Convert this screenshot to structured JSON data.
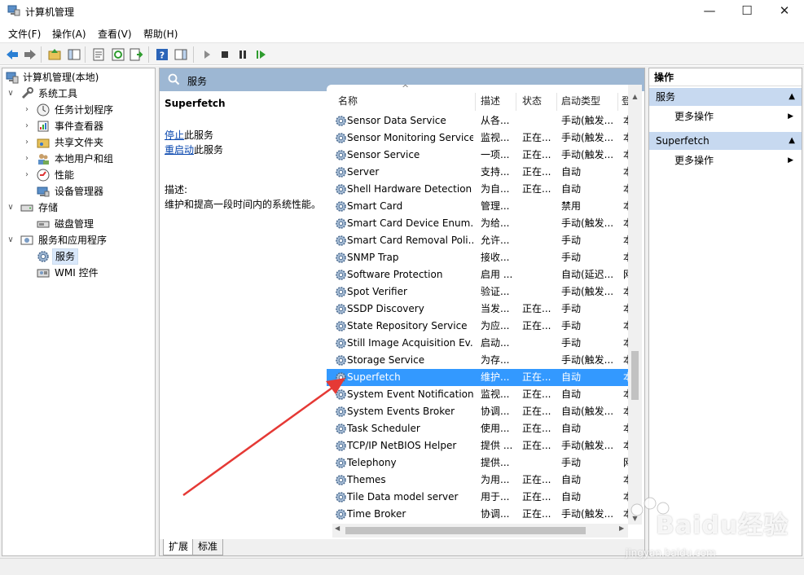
{
  "window": {
    "title": "计算机管理"
  },
  "menubar": [
    "文件(F)",
    "操作(A)",
    "查看(V)",
    "帮助(H)"
  ],
  "tree": {
    "root": "计算机管理(本地)",
    "system_tools": "系统工具",
    "task_scheduler": "任务计划程序",
    "event_viewer": "事件查看器",
    "shared_folders": "共享文件夹",
    "local_users": "本地用户和组",
    "performance": "性能",
    "device_manager": "设备管理器",
    "storage": "存储",
    "disk_management": "磁盘管理",
    "services_apps": "服务和应用程序",
    "services": "服务",
    "wmi": "WMI 控件"
  },
  "center": {
    "header": "服务",
    "desc": {
      "service_name": "Superfetch",
      "stop_link": "停止",
      "stop_suffix": "此服务",
      "restart_link": "重启动",
      "restart_suffix": "此服务",
      "desc_label": "描述:",
      "desc_text": "维护和提高一段时间内的系统性能。"
    },
    "columns": [
      "名称",
      "描述",
      "状态",
      "启动类型",
      "登"
    ],
    "sort_indicator": "^",
    "rows": [
      {
        "name": "Sensor Data Service",
        "desc": "从各...",
        "status": "",
        "startup": "手动(触发...",
        "login": "本"
      },
      {
        "name": "Sensor Monitoring Service",
        "desc": "监视...",
        "status": "正在...",
        "startup": "手动(触发...",
        "login": "本"
      },
      {
        "name": "Sensor Service",
        "desc": "一项...",
        "status": "正在...",
        "startup": "手动(触发...",
        "login": "本"
      },
      {
        "name": "Server",
        "desc": "支持...",
        "status": "正在...",
        "startup": "自动",
        "login": "本"
      },
      {
        "name": "Shell Hardware Detection",
        "desc": "为自...",
        "status": "正在...",
        "startup": "自动",
        "login": "本"
      },
      {
        "name": "Smart Card",
        "desc": "管理...",
        "status": "",
        "startup": "禁用",
        "login": "本"
      },
      {
        "name": "Smart Card Device Enum...",
        "desc": "为给...",
        "status": "",
        "startup": "手动(触发...",
        "login": "本"
      },
      {
        "name": "Smart Card Removal Poli...",
        "desc": "允许...",
        "status": "",
        "startup": "手动",
        "login": "本"
      },
      {
        "name": "SNMP Trap",
        "desc": "接收...",
        "status": "",
        "startup": "手动",
        "login": "本"
      },
      {
        "name": "Software Protection",
        "desc": "启用 ...",
        "status": "",
        "startup": "自动(延迟...",
        "login": "网"
      },
      {
        "name": "Spot Verifier",
        "desc": "验证...",
        "status": "",
        "startup": "手动(触发...",
        "login": "本"
      },
      {
        "name": "SSDP Discovery",
        "desc": "当发...",
        "status": "正在...",
        "startup": "手动",
        "login": "本"
      },
      {
        "name": "State Repository Service",
        "desc": "为应...",
        "status": "正在...",
        "startup": "手动",
        "login": "本"
      },
      {
        "name": "Still Image Acquisition Ev...",
        "desc": "启动...",
        "status": "",
        "startup": "手动",
        "login": "本"
      },
      {
        "name": "Storage Service",
        "desc": "为存...",
        "status": "",
        "startup": "手动(触发...",
        "login": "本"
      },
      {
        "name": "Superfetch",
        "desc": "维护...",
        "status": "正在...",
        "startup": "自动",
        "login": "本"
      },
      {
        "name": "System Event Notification...",
        "desc": "监视...",
        "status": "正在...",
        "startup": "自动",
        "login": "本"
      },
      {
        "name": "System Events Broker",
        "desc": "协调...",
        "status": "正在...",
        "startup": "自动(触发...",
        "login": "本"
      },
      {
        "name": "Task Scheduler",
        "desc": "使用...",
        "status": "正在...",
        "startup": "自动",
        "login": "本"
      },
      {
        "name": "TCP/IP NetBIOS Helper",
        "desc": "提供 ...",
        "status": "正在...",
        "startup": "手动(触发...",
        "login": "本"
      },
      {
        "name": "Telephony",
        "desc": "提供...",
        "status": "",
        "startup": "手动",
        "login": "网"
      },
      {
        "name": "Themes",
        "desc": "为用...",
        "status": "正在...",
        "startup": "自动",
        "login": "本"
      },
      {
        "name": "Tile Data model server",
        "desc": "用于...",
        "status": "正在...",
        "startup": "自动",
        "login": "本"
      },
      {
        "name": "Time Broker",
        "desc": "协调...",
        "status": "正在...",
        "startup": "手动(触发...",
        "login": "本"
      }
    ],
    "selected_row": "Superfetch",
    "tabs": [
      "扩展",
      "标准"
    ]
  },
  "actions": {
    "title": "操作",
    "group1": "服务",
    "item1": "更多操作",
    "group2": "Superfetch",
    "item2": "更多操作"
  },
  "watermark": {
    "brand": "Baidu经验",
    "url": "jingyan.baidu.com"
  },
  "colors": {
    "selection": "#3399ff",
    "header_bar": "#9db7d3",
    "action_group": "#c7d9f0",
    "annotation_arrow": "#e53935"
  }
}
